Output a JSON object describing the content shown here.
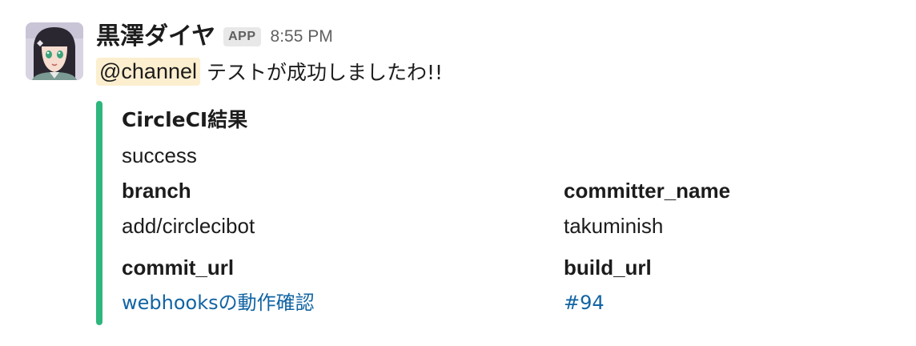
{
  "message": {
    "sender": "黒澤ダイヤ",
    "badge": "APP",
    "timestamp": "8:55 PM",
    "mention": "@channel",
    "text": "テストが成功しましたわ!!"
  },
  "attachment": {
    "accent_color": "#2eb67d",
    "title": "CircleCI結果",
    "text": "success",
    "fields": [
      {
        "title": "branch",
        "value": "add/circlecibot",
        "is_link": false
      },
      {
        "title": "committer_name",
        "value": "takuminish",
        "is_link": false
      },
      {
        "title": "commit_url",
        "value": "webhooksの動作確認",
        "is_link": true
      },
      {
        "title": "build_url",
        "value": "#94",
        "is_link": true
      }
    ]
  },
  "colors": {
    "link": "#1264a3",
    "mention_bg": "#fcefcf",
    "timestamp": "#616061"
  }
}
